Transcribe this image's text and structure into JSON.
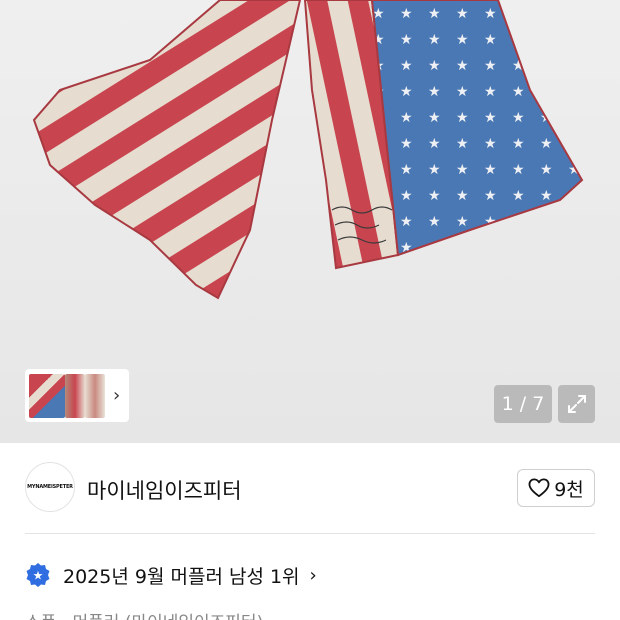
{
  "gallery": {
    "page_indicator": "1 / 7",
    "expand_icon": "expand-icon",
    "thumbnail_chevron": "chevron-right-icon"
  },
  "shop": {
    "logo_text": "MYNAMEISPETER",
    "name": "마이네임이즈피터",
    "like_count": "9천",
    "like_icon": "heart-outline-icon"
  },
  "ranking": {
    "badge_icon": "star-badge-icon",
    "text": "2025년 9월 머플러 남성 1위",
    "chevron": "chevron-right-icon"
  },
  "breadcrumb": {
    "text": "소품 · 머플러 (마이네임이즈피터)"
  },
  "colors": {
    "stripe_red": "#c8454f",
    "canton_blue": "#4a78b4",
    "badge_blue": "#2f6de1"
  }
}
